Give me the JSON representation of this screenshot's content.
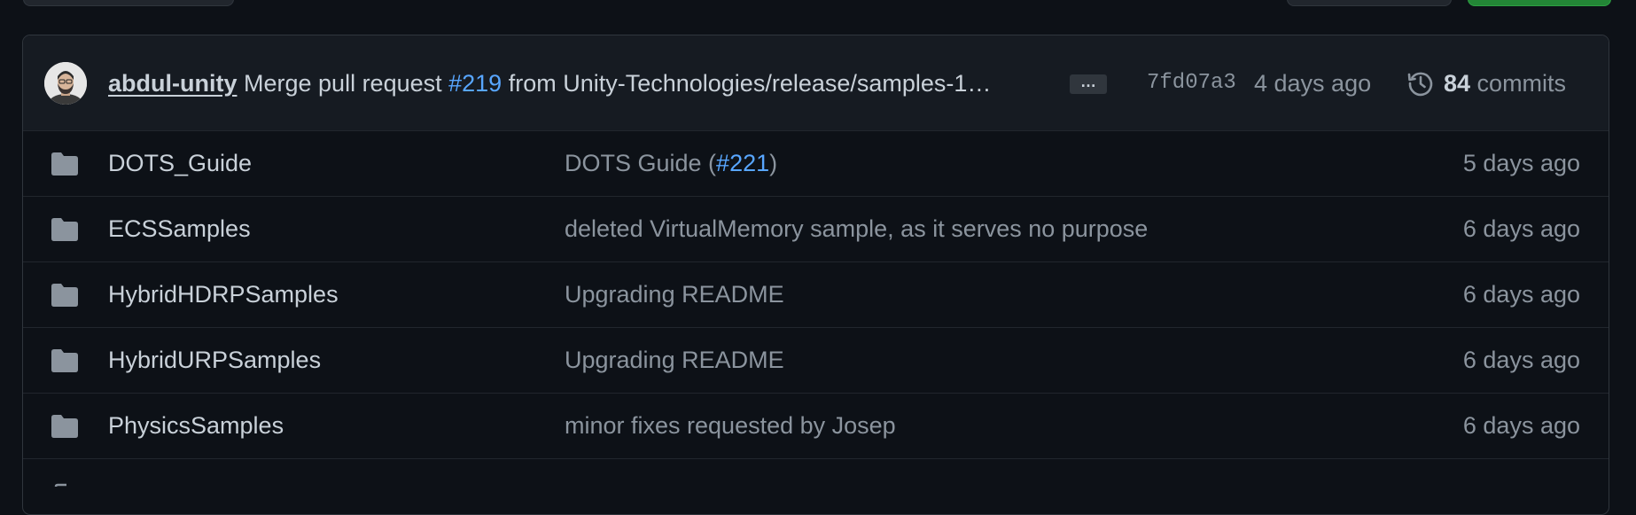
{
  "latest_commit": {
    "author": "abdul-unity",
    "message_prefix": "Merge pull request ",
    "pr_link": "#219",
    "message_suffix": " from Unity-Technologies/release/samples-1…",
    "expand_label": "…",
    "sha": "7fd07a3",
    "time": "4 days ago",
    "commit_count": "84",
    "commit_label": " commits"
  },
  "files": [
    {
      "name": "DOTS_Guide",
      "msg_text": "DOTS Guide (",
      "msg_link": "#221",
      "msg_after": ")",
      "age": "5 days ago"
    },
    {
      "name": "ECSSamples",
      "msg_text": "deleted VirtualMemory sample, as it serves no purpose",
      "msg_link": "",
      "msg_after": "",
      "age": "6 days ago"
    },
    {
      "name": "HybridHDRPSamples",
      "msg_text": "Upgrading README",
      "msg_link": "",
      "msg_after": "",
      "age": "6 days ago"
    },
    {
      "name": "HybridURPSamples",
      "msg_text": "Upgrading README",
      "msg_link": "",
      "msg_after": "",
      "age": "6 days ago"
    },
    {
      "name": "PhysicsSamples",
      "msg_text": "minor fixes requested by Josep",
      "msg_link": "",
      "msg_after": "",
      "age": "6 days ago"
    }
  ],
  "icons": {
    "folder": "folder-icon",
    "history": "history-icon",
    "avatar": "avatar"
  },
  "colors": {
    "background": "#0d1117",
    "header": "#161b22",
    "text": "#c9d1d9",
    "muted": "#8b949e",
    "link": "#58a6ff",
    "folder": "#8b949e"
  }
}
